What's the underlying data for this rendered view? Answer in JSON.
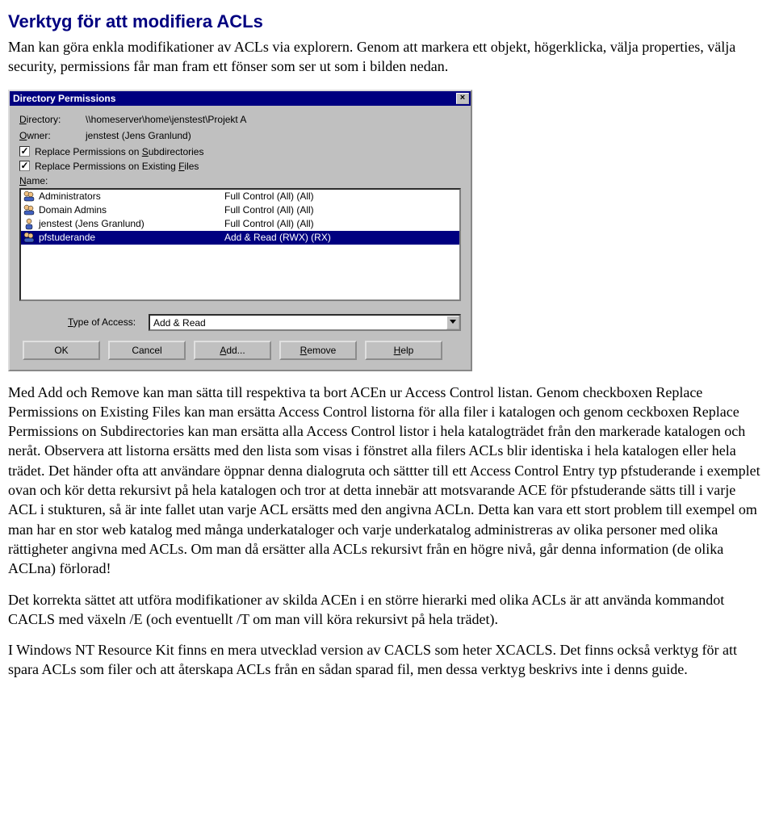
{
  "heading": "Verktyg för att modifiera ACLs",
  "intro": "Man kan göra enkla modifikationer av ACLs via explorern. Genom att markera ett objekt, högerklicka, välja properties, välja security, permissions får man fram ett fönser som ser ut som i bilden nedan.",
  "dialog": {
    "title": "Directory Permissions",
    "dir_label": "Directory:",
    "dir_u": "D",
    "directory": "\\\\homeserver\\home\\jenstest\\Projekt A",
    "owner_label": "Owner:",
    "owner_u": "O",
    "owner": "jenstest (Jens Granlund)",
    "cb_subdirs": "Replace Permissions on Subdirectories",
    "cb_subdirs_u": "S",
    "cb_files": "Replace Permissions on Existing Files",
    "cb_files_u": "F",
    "name_label": "Name:",
    "name_u": "N",
    "list": [
      {
        "name": "Administrators",
        "perm": "Full Control (All) (All)",
        "selected": false,
        "icon": "group"
      },
      {
        "name": "Domain Admins",
        "perm": "Full Control (All) (All)",
        "selected": false,
        "icon": "group"
      },
      {
        "name": "jenstest (Jens Granlund)",
        "perm": "Full Control (All) (All)",
        "selected": false,
        "icon": "user"
      },
      {
        "name": "pfstuderande",
        "perm": "Add & Read (RWX) (RX)",
        "selected": true,
        "icon": "group"
      }
    ],
    "access_label": "Type of Access:",
    "access_u": "T",
    "access_value": "Add & Read",
    "buttons": {
      "ok": "OK",
      "cancel": "Cancel",
      "add": "Add...",
      "add_u": "A",
      "remove": "Remove",
      "remove_u": "R",
      "help": "Help",
      "help_u": "H"
    }
  },
  "para1": "Med Add och Remove kan man sätta till respektiva ta bort ACEn ur Access Control listan. Genom checkboxen Replace Permissions on Existing Files kan man ersätta Access Control listorna för alla filer i katalogen och genom ceckboxen Replace Permissions on Subdirectories kan man ersätta alla Access Control listor i hela katalogträdet från den markerade katalogen och neråt. Observera att listorna ersätts med den lista som visas i fönstret alla filers ACLs blir identiska i hela katalogen eller hela trädet. Det händer ofta att användare öppnar denna dialogruta och sättter till ett Access Control Entry typ pfstuderande i exemplet ovan och kör detta rekursivt på hela katalogen och tror at detta innebär att motsvarande ACE för pfstuderande sätts till i varje ACL i stukturen, så är inte fallet utan varje ACL ersätts med den angivna ACLn. Detta kan vara ett stort problem till exempel om man har en stor web katalog med många underkataloger och varje underkatalog administreras av olika personer med olika rättigheter angivna med ACLs. Om man då ersätter alla ACLs rekursivt från en högre nivå, går denna information (de olika ACLna) förlorad!",
  "para2": "Det korrekta sättet att utföra modifikationer av skilda ACEn i en större hierarki med olika ACLs är att använda kommandot CACLS med växeln /E (och eventuellt /T om man vill köra rekursivt på hela trädet).",
  "para3": "I Windows NT Resource Kit finns en mera utvecklad version av CACLS som heter XCACLS. Det finns också verktyg för att spara ACLs som filer och att återskapa ACLs från en sådan sparad fil, men dessa verktyg beskrivs inte i denns guide."
}
